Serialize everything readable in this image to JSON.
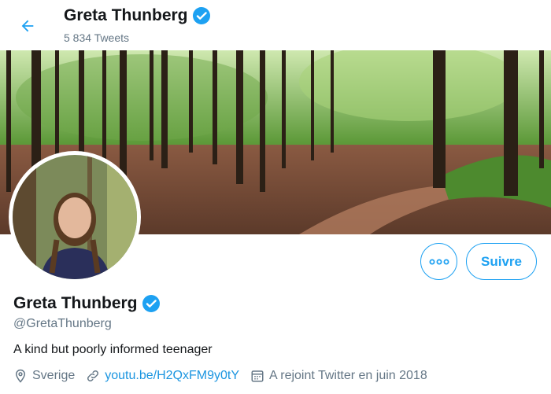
{
  "header": {
    "name": "Greta Thunberg",
    "tweet_count": "5 834 Tweets"
  },
  "profile": {
    "name": "Greta Thunberg",
    "handle": "@GretaThunberg",
    "bio": "A kind but poorly informed teenager",
    "location": "Sverige",
    "website": "youtu.be/H2QxFM9y0tY",
    "joined": "A rejoint Twitter en juin 2018"
  },
  "actions": {
    "follow_label": "Suivre"
  },
  "icons": {
    "back": "arrow-left-icon",
    "verified": "verified-badge-icon",
    "more": "more-options-icon",
    "location": "location-pin-icon",
    "link": "link-icon",
    "calendar": "calendar-icon"
  },
  "colors": {
    "accent": "#1da1f2",
    "link": "#1b95e0",
    "secondary_text": "#657786"
  }
}
